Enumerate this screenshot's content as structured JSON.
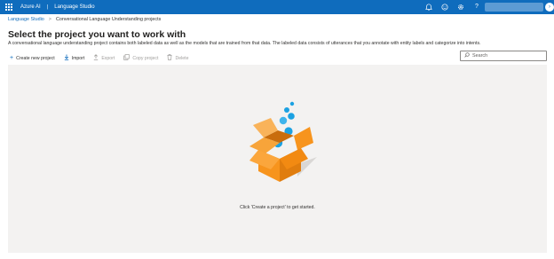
{
  "header": {
    "brand": "Azure AI",
    "separator": "|",
    "app_name": "Language Studio",
    "icons": [
      "waffle-icon",
      "bell-icon",
      "smiley-icon",
      "gear-icon",
      "help-icon"
    ]
  },
  "breadcrumb": {
    "items": [
      "Language Studio",
      "Conversational Language Understanding projects"
    ],
    "separator": ">"
  },
  "page": {
    "title": "Select the project you want to work with",
    "description": "A conversational language understanding project contains both labeled data as well as the models that are trained from that data. The labeled data consists of utterances that you annotate with entity labels and categorize into intents."
  },
  "toolbar": {
    "items": [
      {
        "label": "Create new project",
        "icon": "plus-icon",
        "enabled": true
      },
      {
        "label": "Import",
        "icon": "import-icon",
        "enabled": true
      },
      {
        "label": "Export",
        "icon": "export-icon",
        "enabled": false
      },
      {
        "label": "Copy project",
        "icon": "copy-icon",
        "enabled": false
      },
      {
        "label": "Delete",
        "icon": "trash-icon",
        "enabled": false
      }
    ]
  },
  "search": {
    "placeholder": "Search",
    "value": ""
  },
  "empty_state": {
    "message": "Click 'Create a project' to get started."
  },
  "colors": {
    "accent": "#0f6cbd",
    "box": "#f7941d",
    "bubble": "#1ba1e2",
    "panel": "#f3f2f1"
  }
}
